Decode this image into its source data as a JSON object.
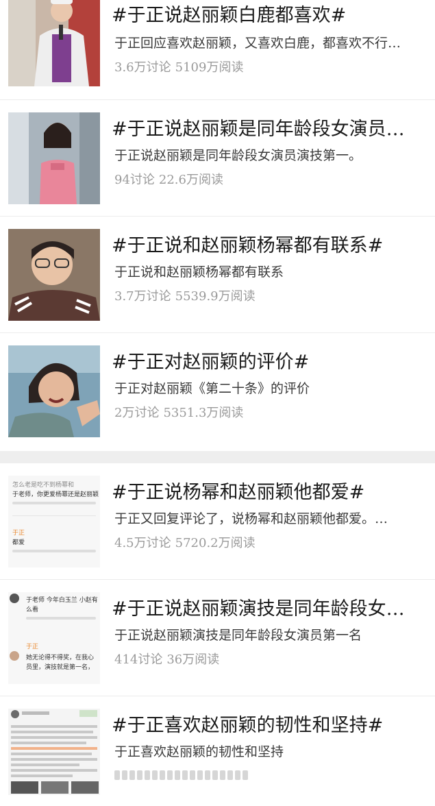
{
  "topics": [
    {
      "title": "#于正说赵丽颖白鹿都喜欢#",
      "desc": "于正回应喜欢赵丽颖，又喜欢白鹿，都喜欢不行…",
      "discussions": "3.6万讨论",
      "reads": "5109万阅读",
      "thumb_icon": "person-photo-icon"
    },
    {
      "title": "#于正说赵丽颖是同年龄段女演员…",
      "desc": "于正说赵丽颖是同年龄段女演员演技第一。",
      "discussions": "94讨论",
      "reads": "22.6万阅读",
      "thumb_icon": "person-photo-icon"
    },
    {
      "title": "#于正说和赵丽颖杨幂都有联系#",
      "desc": "于正说和赵丽颖杨幂都有联系",
      "discussions": "3.7万讨论",
      "reads": "5539.9万阅读",
      "thumb_icon": "person-photo-icon"
    },
    {
      "title": "#于正对赵丽颖的评价#",
      "desc": "于正对赵丽颖《第二十条》的评价",
      "discussions": "2万讨论",
      "reads": "5351.3万阅读",
      "thumb_icon": "person-photo-icon"
    },
    {
      "title": "#于正说杨幂和赵丽颖他都爱#",
      "desc": "于正又回复评论了，说杨幂和赵丽颖他都爱。…",
      "discussions": "4.5万讨论",
      "reads": "5720.2万阅读",
      "thumb": {
        "line1": "怎么老是吃不到杨幂和",
        "line2": "于老师，你更爱杨幂还是赵丽颖",
        "name": "于正",
        "reply": "都爱"
      }
    },
    {
      "title": "#于正说赵丽颖演技是同年龄段女…",
      "desc": "于正说赵丽颖演技是同年龄段女演员第一名",
      "discussions": "414讨论",
      "reads": "36万阅读",
      "thumb": {
        "line1": "于老师 今年白玉兰 小赵有",
        "line2": "么看",
        "name": "于正",
        "reply": "她无论得不得奖，在我心",
        "reply2": "员里，演技就是第一名，"
      }
    },
    {
      "title": "#于正喜欢赵丽颖的韧性和坚持#",
      "desc": "于正喜欢赵丽颖的韧性和坚持",
      "discussions": "",
      "reads": "",
      "thumb_icon": "document-screenshot-icon"
    }
  ],
  "colors": {
    "title": "#1a1a1a",
    "desc": "#3a3a3a",
    "stats": "#9a9a9a",
    "divider": "#eeeeee",
    "accent_name": "#e8862a"
  }
}
